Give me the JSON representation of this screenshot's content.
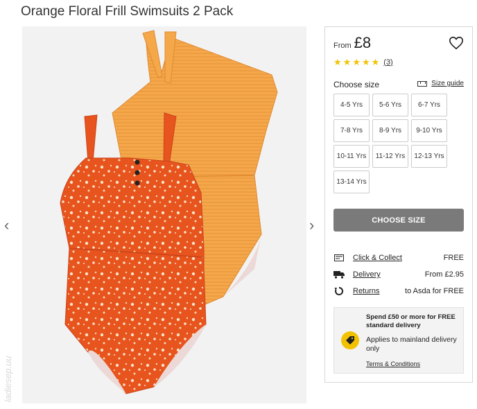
{
  "product": {
    "title": "Orange Floral Frill Swimsuits 2 Pack",
    "from_label": "From",
    "price": "£8",
    "rating_count": "(3)",
    "stars": 5
  },
  "sizes": {
    "label": "Choose size",
    "guide_label": "Size guide",
    "options": [
      "4-5 Yrs",
      "5-6 Yrs",
      "6-7 Yrs",
      "7-8 Yrs",
      "8-9 Yrs",
      "9-10 Yrs",
      "10-11 Yrs",
      "11-12 Yrs",
      "12-13 Yrs",
      "13-14 Yrs"
    ]
  },
  "cta": {
    "label": "CHOOSE SIZE"
  },
  "delivery": {
    "click_collect": {
      "label": "Click & Collect",
      "value": "FREE",
      "icon": "store-icon"
    },
    "home": {
      "label": "Delivery",
      "value": "From £2.95",
      "icon": "truck-icon"
    },
    "returns": {
      "label": "Returns",
      "value": "to Asda for FREE",
      "icon": "return-icon"
    }
  },
  "promo": {
    "headline": "Spend £50 or more for FREE standard delivery",
    "sub": "Applies to mainland delivery only",
    "terms": "Terms & Conditions",
    "icon": "tag-icon"
  },
  "watermark": "ladiesep.uu",
  "colors": {
    "accent_yellow": "#f2c200",
    "button_gray": "#7a7a7a",
    "swimsuit_orange": "#e8541e",
    "swimsuit_yellow": "#f4a84a"
  }
}
